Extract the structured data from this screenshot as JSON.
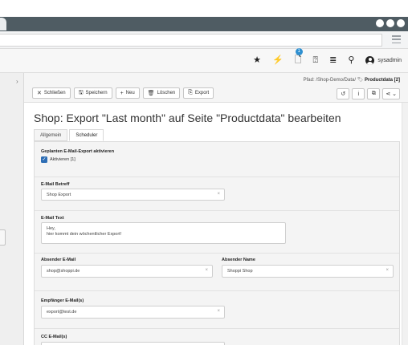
{
  "browser": {
    "window_dots": 3
  },
  "topbar": {
    "notification_count": "1",
    "username": "sysadmin",
    "icons": [
      "star-icon",
      "flash-icon",
      "document-icon",
      "help-icon",
      "list-icon",
      "search-icon",
      "user-avatar-icon"
    ]
  },
  "editor": {
    "path_label": "Pfad: /Shop-Demo/Data/",
    "path_current": "Productdata [2]",
    "toolbar": {
      "close": "Schließen",
      "save": "Speichern",
      "new": "Neu",
      "delete": "Löschen",
      "export": "Export"
    },
    "right_tools": [
      "history-icon",
      "info-icon",
      "open-external-icon",
      "share-icon"
    ]
  },
  "page": {
    "title": "Shop: Export \"Last month\" auf Seite \"Productdata\" bearbeiten",
    "tabs": [
      "Allgemein",
      "Scheduler"
    ],
    "active_tab": "Scheduler"
  },
  "form": {
    "schedule_label": "Geplanten E-Mail-Export aktivieren",
    "schedule_checkbox": "Aktivieren [1]",
    "subject_label": "E-Mail Betreff",
    "subject_value": "Shop Export",
    "text_label": "E-Mail Text",
    "text_line1": "Hey,",
    "text_line2": "hier kommt dein wöchentlicher Export!",
    "sender_email_label": "Absender E-Mail",
    "sender_email_value": "shop@shoppi.de",
    "sender_name_label": "Absender Name",
    "sender_name_value": "Shoppi Shop",
    "recipient_label": "Empfänger E-Mail(s)",
    "recipient_value": "export@test.de",
    "cc_label": "CC E-Mail(s)"
  },
  "colors": {
    "titlebar": "#4f5c63",
    "accent": "#2d6db4",
    "badge": "#2d8fd0"
  }
}
